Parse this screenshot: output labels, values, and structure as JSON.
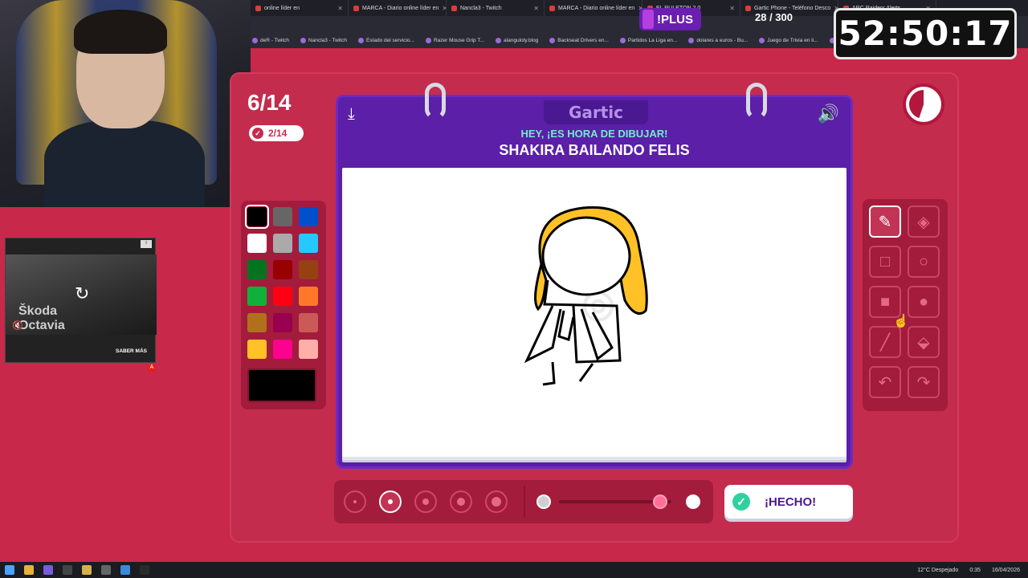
{
  "browser": {
    "tabs": [
      {
        "label": "online líder en",
        "icon": "marca-icon"
      },
      {
        "label": "MARCA - Diario online líder en",
        "icon": "marca-icon"
      },
      {
        "label": "Nancla3 - Twitch",
        "icon": "twitch-icon"
      },
      {
        "label": "MARCA - Diario online líder en",
        "icon": "marca-icon"
      },
      {
        "label": "EL RULETON 2.0",
        "icon": "page-icon"
      },
      {
        "label": "Gartic Phone - Teléfono Desco",
        "icon": "gartic-icon"
      },
      {
        "label": "ARC Raiders Alerts",
        "icon": "x-icon"
      }
    ],
    "bookmarks": [
      "deR - Twitch",
      "Nancla3 - Twitch",
      "Estado del servicio...",
      "Razer Mouse Grip T...",
      "alanguloty.blog",
      "Backseat Drivers en...",
      "Partidos La Liga en...",
      "dolares a euros - Bu...",
      "Juego de Trivia en li...",
      "Auriculares Philips |..."
    ]
  },
  "overlay": {
    "plus_label": "!PLUS",
    "counter": "28 / 300",
    "timer": "52:50:17"
  },
  "ad": {
    "title_line1": "Škoda",
    "title_line2": "Octavia",
    "cta": "SABER MÁS"
  },
  "game": {
    "round": "6/14",
    "done_count": "2/14",
    "logo": "Gartic",
    "prompt_subtitle": "HEY, ¡ES HORA DE DIBUJAR!",
    "prompt_word": "SHAKIRA BAILANDO FELIS",
    "done_button": "¡HECHO!",
    "palette": [
      "#000000",
      "#666666",
      "#0050cd",
      "#ffffff",
      "#aaaaaa",
      "#26c9ff",
      "#017420",
      "#990000",
      "#964112",
      "#11b03c",
      "#ff0013",
      "#ff7829",
      "#b0701c",
      "#99004e",
      "#cb5a57",
      "#ffc126",
      "#ff008f",
      "#feafa8"
    ],
    "selected_color": "#000000",
    "brush_sizes": [
      1,
      2,
      3,
      4,
      5
    ],
    "selected_brush_index": 1,
    "opacity_value": 0.9
  },
  "taskbar": {
    "weather": "12°C Despejado",
    "time": "0:35",
    "date": "16/04/2026"
  }
}
